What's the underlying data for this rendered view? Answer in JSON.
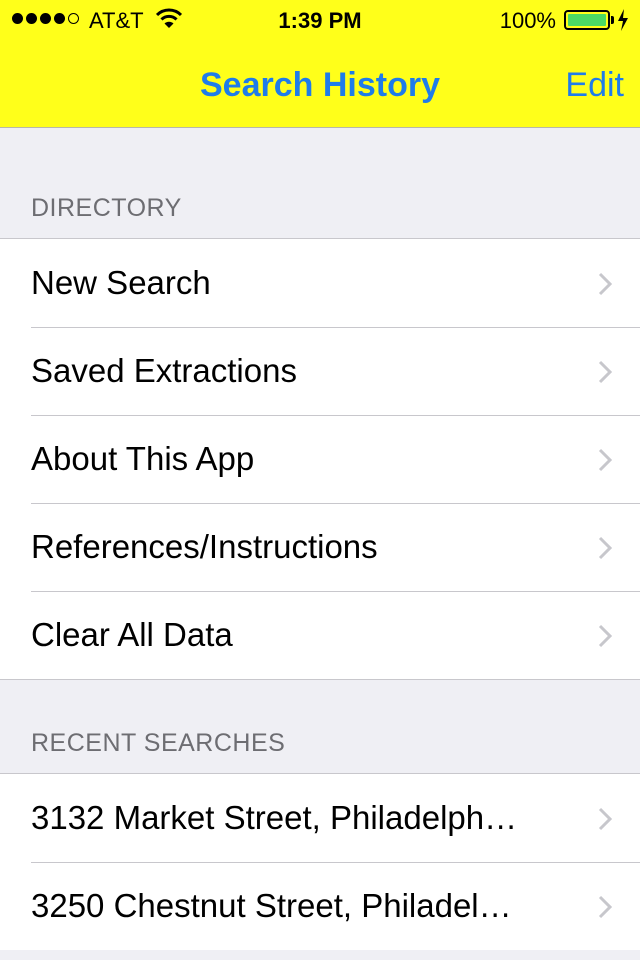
{
  "status_bar": {
    "carrier": "AT&T",
    "time": "1:39 PM",
    "battery_percent": "100%",
    "signal_bars_filled": 4,
    "signal_bars_total": 5
  },
  "nav": {
    "title": "Search History",
    "edit_label": "Edit"
  },
  "colors": {
    "header_bg": "#ffff1a",
    "accent": "#1f7cea",
    "battery": "#4cd964"
  },
  "directory": {
    "header": "DIRECTORY",
    "items": [
      {
        "label": "New Search"
      },
      {
        "label": "Saved Extractions"
      },
      {
        "label": "About This App"
      },
      {
        "label": "References/Instructions"
      },
      {
        "label": "Clear All Data"
      }
    ]
  },
  "recent": {
    "header": "RECENT SEARCHES",
    "items": [
      {
        "label": "3132 Market Street, Philadelph…"
      },
      {
        "label": "3250 Chestnut Street, Philadel…"
      }
    ]
  },
  "icons": {
    "row_disclosure": "chevron-right-icon",
    "wifi": "wifi-icon",
    "battery": "battery-icon",
    "charging": "bolt-icon"
  }
}
